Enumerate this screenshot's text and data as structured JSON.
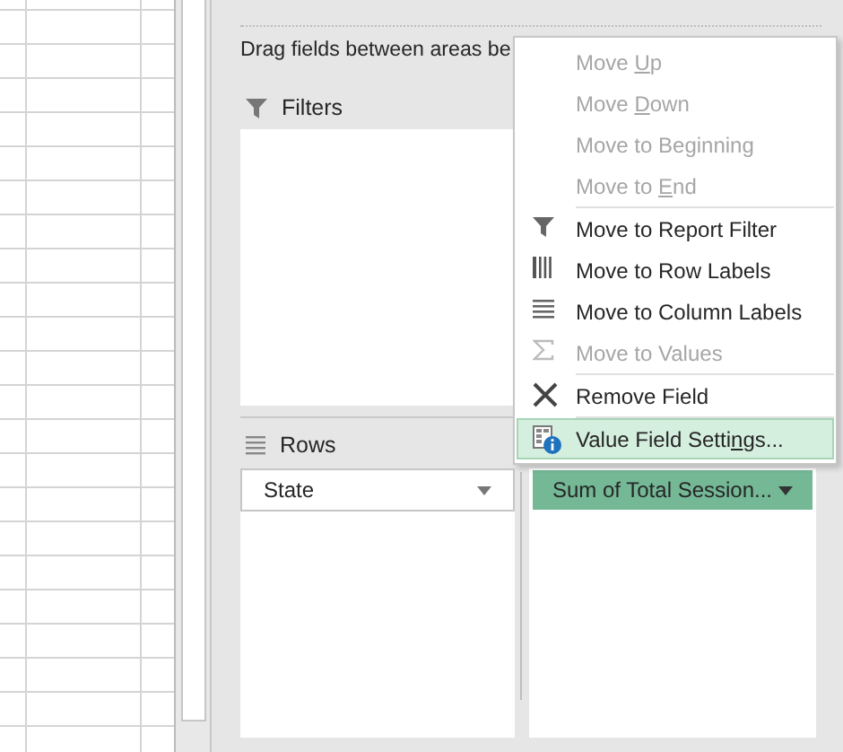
{
  "panel": {
    "instruction": "Drag fields between areas be",
    "filters": {
      "label": "Filters"
    },
    "rows": {
      "label": "Rows",
      "fields": [
        {
          "label": "State",
          "selected": false
        }
      ]
    },
    "values": {
      "fields": [
        {
          "label": "Sum of Total Session...",
          "selected": true
        }
      ]
    }
  },
  "context_menu": {
    "items": [
      {
        "label": "Move ",
        "access_key": "U",
        "label_after": "p",
        "kind": "none",
        "disabled": true,
        "selected": false,
        "separator_before": false
      },
      {
        "label": "Move ",
        "access_key": "D",
        "label_after": "own",
        "kind": "none",
        "disabled": true,
        "selected": false,
        "separator_before": false
      },
      {
        "label": "Move to Beginning",
        "kind": "none",
        "disabled": true,
        "selected": false,
        "separator_before": false
      },
      {
        "label": "Move to ",
        "access_key": "E",
        "label_after": "nd",
        "kind": "none",
        "disabled": true,
        "selected": false,
        "separator_before": false
      },
      {
        "label": "Move to Report Filter",
        "kind": "funnel",
        "disabled": false,
        "selected": false,
        "separator_before": true
      },
      {
        "label": "Move to Row Labels",
        "kind": "columns",
        "disabled": false,
        "selected": false,
        "separator_before": false
      },
      {
        "label": "Move to Column Labels",
        "kind": "lines",
        "disabled": false,
        "selected": false,
        "separator_before": false
      },
      {
        "label": "Move to Values",
        "kind": "sigma",
        "disabled": true,
        "selected": false,
        "separator_before": false
      },
      {
        "label": "Remove Field",
        "kind": "cross",
        "disabled": false,
        "selected": false,
        "separator_before": true
      },
      {
        "label": "Value Field Setti",
        "access_key": "n",
        "label_after": "gs...",
        "kind": "settings",
        "disabled": false,
        "selected": true,
        "separator_before": true
      }
    ]
  }
}
